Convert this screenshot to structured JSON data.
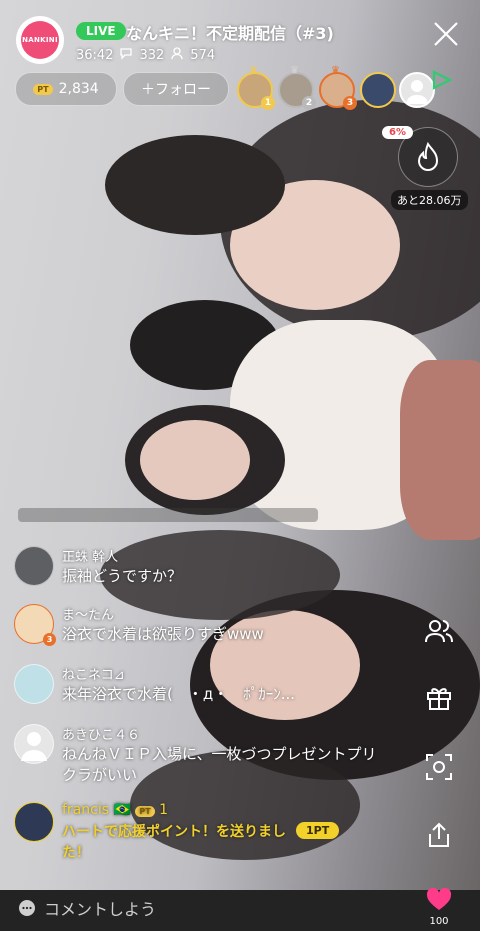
{
  "header": {
    "logo_text": "NANKINI",
    "live_label": "LIVE",
    "title": "なんキニ！不定期配信（#3)",
    "duration": "36:42",
    "comment_count": "332",
    "viewer_count": "574"
  },
  "points_pill": {
    "badge": "PT",
    "value": "2,834"
  },
  "follow_button": {
    "label": "＋フォロー"
  },
  "rankers": [
    {
      "rank": "1",
      "color": "#f2c94c"
    },
    {
      "rank": "2",
      "color": "#b9b9b9"
    },
    {
      "rank": "3",
      "color": "#e8702a"
    }
  ],
  "fire_meter": {
    "percent": "6%",
    "remaining": "あと28.06万"
  },
  "comments": [
    {
      "name": "正蛛 幹人",
      "text": "振袖どうですか？"
    },
    {
      "name": "ま〜たん",
      "text": "浴衣で水着は欲張りすぎwww",
      "badge": "3"
    },
    {
      "name": "ねこネコ⊿",
      "text": "来年浴衣で水着(　・д・　ﾎﾟｶｰﾝ..."
    },
    {
      "name": "あきひこ４６",
      "text": "ねんねＶＩＰ入場に、一枚づつプレゼントプリクラがいい"
    },
    {
      "name": "francis",
      "flag": "🇧🇷",
      "pt_badge": "PT",
      "pt_value": "1",
      "text": "ハートで応援ポイント！を送りました！",
      "chip": "1PT"
    }
  ],
  "bottom_bar": {
    "placeholder": "コメントしよう",
    "heart_count": "100"
  },
  "colors": {
    "live": "#34c759",
    "accent_pink": "#ef4d78",
    "gold": "#f2c94c",
    "heart": "#ff3b8a"
  }
}
